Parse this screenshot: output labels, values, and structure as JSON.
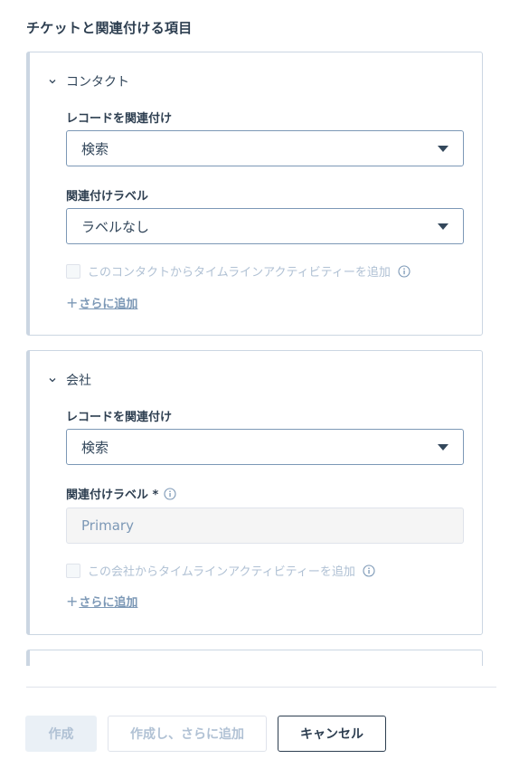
{
  "heading": "チケットと関連付ける項目",
  "contact_section": {
    "title": "コンタクト",
    "record_label": "レコードを関連付け",
    "record_value": "検索",
    "assoc_label": "関連付けラベル",
    "assoc_value": "ラベルなし",
    "timeline_text": "このコンタクトからタイムラインアクティビティーを追加",
    "add_more_plus": "+",
    "add_more": "さらに追加"
  },
  "company_section": {
    "title": "会社",
    "record_label": "レコードを関連付け",
    "record_value": "検索",
    "assoc_label": "関連付けラベル *",
    "assoc_value": "Primary",
    "timeline_text": "この会社からタイムラインアクティビティーを追加",
    "add_more_plus": "+",
    "add_more": "さらに追加"
  },
  "footer": {
    "create": "作成",
    "create_more": "作成し、さらに追加",
    "cancel": "キャンセル"
  },
  "colors": {
    "text": "#33475b",
    "border": "#cbd6e2",
    "disabled": "#b0c1d4",
    "dark": "#2d3e50"
  }
}
